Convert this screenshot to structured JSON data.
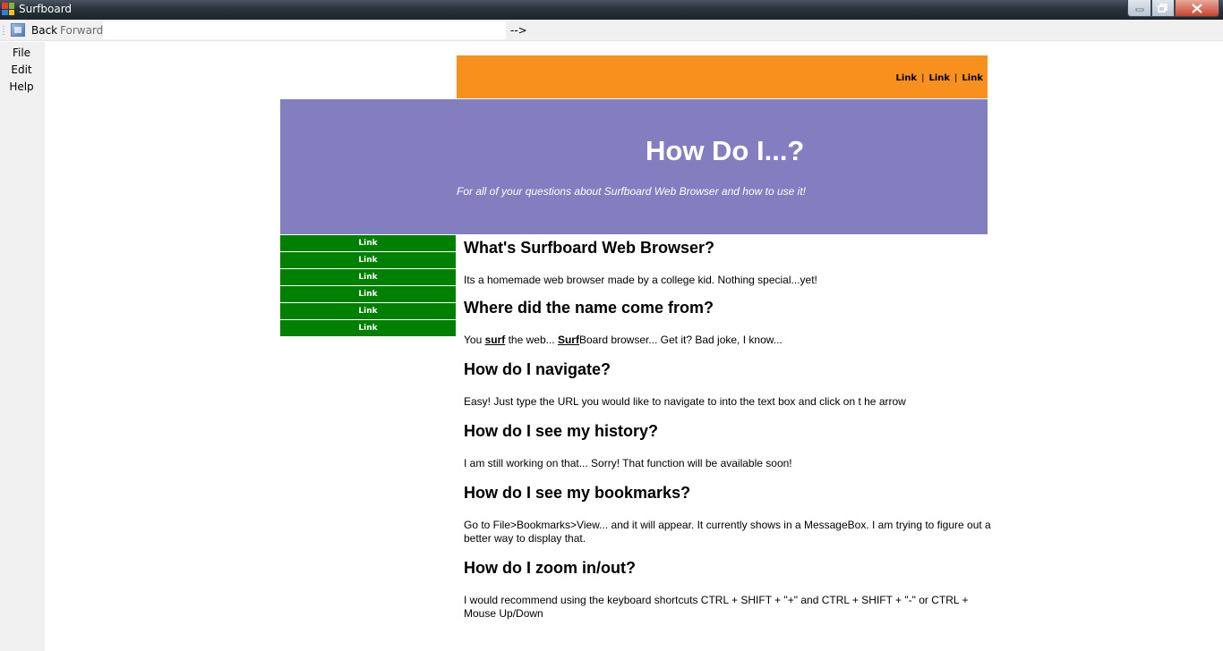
{
  "window": {
    "title": "Surfboard",
    "icon": "app-windows-icon",
    "controls": [
      "minimize-icon",
      "maximize-icon",
      "close-icon"
    ]
  },
  "toolbar": {
    "back_label": "Back",
    "forward_label": "Forward",
    "url_value": "",
    "go_label": "-->"
  },
  "menu": {
    "file": "File",
    "edit": "Edit",
    "help": "Help"
  },
  "page": {
    "top_links": [
      "Link",
      "Link",
      "Link"
    ],
    "title": "How Do I...?",
    "subtitle": "For all of your questions about Surfboard Web Browser and how to use it!",
    "side_links": [
      "Link",
      "Link",
      "Link",
      "Link",
      "Link",
      "Link"
    ],
    "sections": [
      {
        "heading": "What's Surfboard Web Browser?",
        "body": "Its a homemade web browser made by a college kid. Nothing special...yet!"
      },
      {
        "heading": "Where did the name come from?",
        "body_parts": [
          "You ",
          "surf",
          " the web... ",
          "Surf",
          "Board browser... Get it? Bad joke, I know..."
        ]
      },
      {
        "heading": "How do I navigate?",
        "body": "Easy! Just type the URL you would like to navigate to into the text box and click on t he arrow"
      },
      {
        "heading": "How do I see my history?",
        "body": "I am still working on that... Sorry! That function will be available soon!"
      },
      {
        "heading": "How do I see my bookmarks?",
        "body": "Go to File>Bookmarks>View... and it will appear. It currently shows in a MessageBox. I am trying to figure out a better way to display that."
      },
      {
        "heading": "How do I zoom in/out?",
        "body": "I would recommend using the keyboard shortcuts CTRL + SHIFT + \"+\" and CTRL + SHIFT + \"-\" or   CTRL + Mouse Up/Down"
      }
    ]
  },
  "colors": {
    "orange_bar": "#f8901e",
    "banner": "#827ec0",
    "side_nav": "#008000"
  }
}
